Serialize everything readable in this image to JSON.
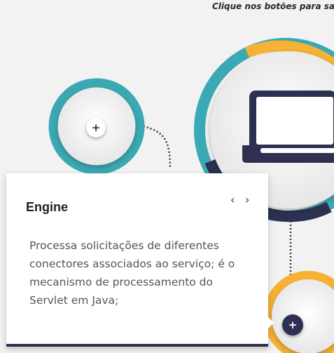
{
  "header": {
    "instruction": "Clique nos botões para sabe"
  },
  "colors": {
    "teal": "#3aa9b3",
    "gold": "#f7b236",
    "navy": "#2d3050",
    "card": "#ffffff"
  },
  "icons": {
    "expand_left": "plus-icon",
    "expand_bottom": "plus-icon",
    "center": "laptop-icon"
  },
  "popup": {
    "title": "Engine",
    "prev_label": "‹",
    "next_label": "›",
    "body": "Processa solicitações de diferentes conectores associados ao serviço; é o mecanismo de processamento do Servlet em Java;"
  },
  "buttons": {
    "plus_label": "+"
  }
}
